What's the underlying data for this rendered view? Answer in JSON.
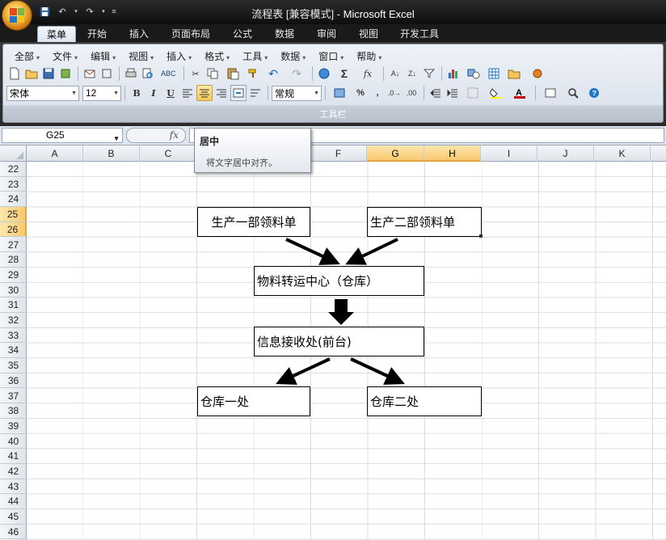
{
  "window": {
    "title_prefix": "流程表  [兼容模式]",
    "title_sep": " - ",
    "app_name": "Microsoft Excel"
  },
  "tabs": [
    {
      "label": "菜单",
      "active": true
    },
    {
      "label": "开始"
    },
    {
      "label": "插入"
    },
    {
      "label": "页面布局"
    },
    {
      "label": "公式"
    },
    {
      "label": "数据"
    },
    {
      "label": "审阅"
    },
    {
      "label": "视图"
    },
    {
      "label": "开发工具"
    }
  ],
  "menubar": [
    "全部",
    "文件",
    "编辑",
    "视图",
    "插入",
    "格式",
    "工具",
    "数据",
    "窗口",
    "帮助"
  ],
  "toolbar": {
    "font_name": "宋体",
    "font_size": "12",
    "number_format": "常规",
    "bold": "B",
    "italic": "I",
    "underline": "U",
    "percent": "%",
    "comma": ",",
    "group_label": "工具栏"
  },
  "formula_bar": {
    "name_box": "G25",
    "fx": "fx",
    "value": ""
  },
  "tooltip": {
    "title": "居中",
    "body": "将文字居中对齐。"
  },
  "grid": {
    "columns": [
      "A",
      "B",
      "C",
      "D",
      "E",
      "F",
      "G",
      "H",
      "I",
      "J",
      "K"
    ],
    "selected_columns": [
      "G",
      "H"
    ],
    "rows": [
      "22",
      "23",
      "24",
      "25",
      "26",
      "27",
      "28",
      "29",
      "30",
      "31",
      "32",
      "33",
      "34",
      "35",
      "36",
      "37",
      "38",
      "39",
      "40",
      "41",
      "42",
      "43",
      "44",
      "45",
      "46"
    ],
    "selected_rows": [
      "25",
      "26"
    ]
  },
  "flowchart": {
    "dept1": "生产一部领料单",
    "dept2": "生产二部领料单",
    "transit": "物料转运中心（仓库）",
    "info": "信息接收处(前台)",
    "wh1": "仓库一处",
    "wh2": "仓库二处"
  },
  "colors": {
    "selection": "#f8c870",
    "tab_active": "#dbe3ee",
    "titlebar": "#1a1a1a"
  }
}
